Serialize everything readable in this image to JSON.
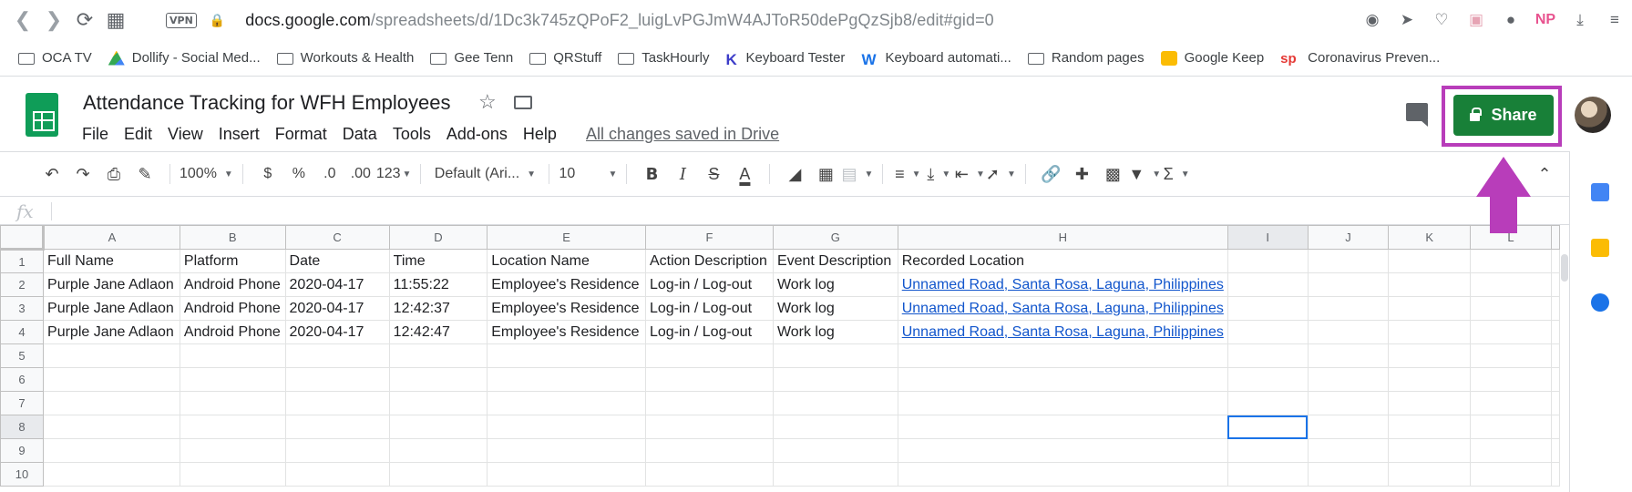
{
  "browser": {
    "vpn": "VPN",
    "url_host": "docs.google.com",
    "url_path": "/spreadsheets/d/1Dc3k745zQPoF2_luigLvPGJmW4AJToR50dePgQzSjb8/edit#gid=0",
    "np_label": "NP",
    "bookmarks": [
      {
        "label": "OCA TV",
        "icon": "folder-icon"
      },
      {
        "label": "Dollify - Social Med...",
        "icon": "drive-icon"
      },
      {
        "label": "Workouts & Health",
        "icon": "folder-icon"
      },
      {
        "label": "Gee Tenn",
        "icon": "folder-icon"
      },
      {
        "label": "QRStuff",
        "icon": "folder-icon"
      },
      {
        "label": "TaskHourly",
        "icon": "folder-icon"
      },
      {
        "label": "Keyboard Tester",
        "icon": "k-icon"
      },
      {
        "label": "Keyboard automati...",
        "icon": "w-icon"
      },
      {
        "label": "Random pages",
        "icon": "folder-icon"
      },
      {
        "label": "Google Keep",
        "icon": "keep-icon"
      },
      {
        "label": "Coronavirus Preven...",
        "icon": "sp-icon"
      }
    ]
  },
  "sheets": {
    "title": "Attendance Tracking for WFH Employees",
    "menu": [
      "File",
      "Edit",
      "View",
      "Insert",
      "Format",
      "Data",
      "Tools",
      "Add-ons",
      "Help"
    ],
    "saved_status": "All changes saved in Drive",
    "share_label": "Share",
    "accent": "#188038",
    "highlight": "#b83dba"
  },
  "toolbar": {
    "zoom": "100%",
    "currency": "$",
    "percent": "%",
    "dec_less": ".0",
    "dec_more": ".00",
    "more_formats": "123",
    "font": "Default (Ari...",
    "font_size": "10",
    "bold": "B",
    "italic": "I",
    "strike": "S",
    "text_color": "A"
  },
  "formula": {
    "fx": "fx",
    "value": ""
  },
  "grid": {
    "columns": [
      "A",
      "B",
      "C",
      "D",
      "E",
      "F",
      "G",
      "H",
      "I",
      "J",
      "K",
      "L"
    ],
    "selected_column": "I",
    "selected_row": 8,
    "rows": [
      [
        "Full Name",
        "Platform",
        "Date",
        "Time",
        "Location Name",
        "Action Description",
        "Event Description",
        "Recorded Location"
      ],
      [
        "Purple Jane Adlaon",
        "Android Phone",
        "2020-04-17",
        "11:55:22",
        "Employee's Residence",
        "Log-in / Log-out",
        "Work log",
        "Unnamed Road, Santa Rosa, Laguna, Philippines"
      ],
      [
        "Purple Jane Adlaon",
        "Android Phone",
        "2020-04-17",
        "12:42:37",
        "Employee's Residence",
        "Log-in / Log-out",
        "Work log",
        "Unnamed Road, Santa Rosa, Laguna, Philippines"
      ],
      [
        "Purple Jane Adlaon",
        "Android Phone",
        "2020-04-17",
        "12:42:47",
        "Employee's Residence",
        "Log-in / Log-out",
        "Work log",
        "Unnamed Road, Santa Rosa, Laguna, Philippines"
      ],
      [],
      [],
      [],
      [],
      [],
      []
    ]
  }
}
